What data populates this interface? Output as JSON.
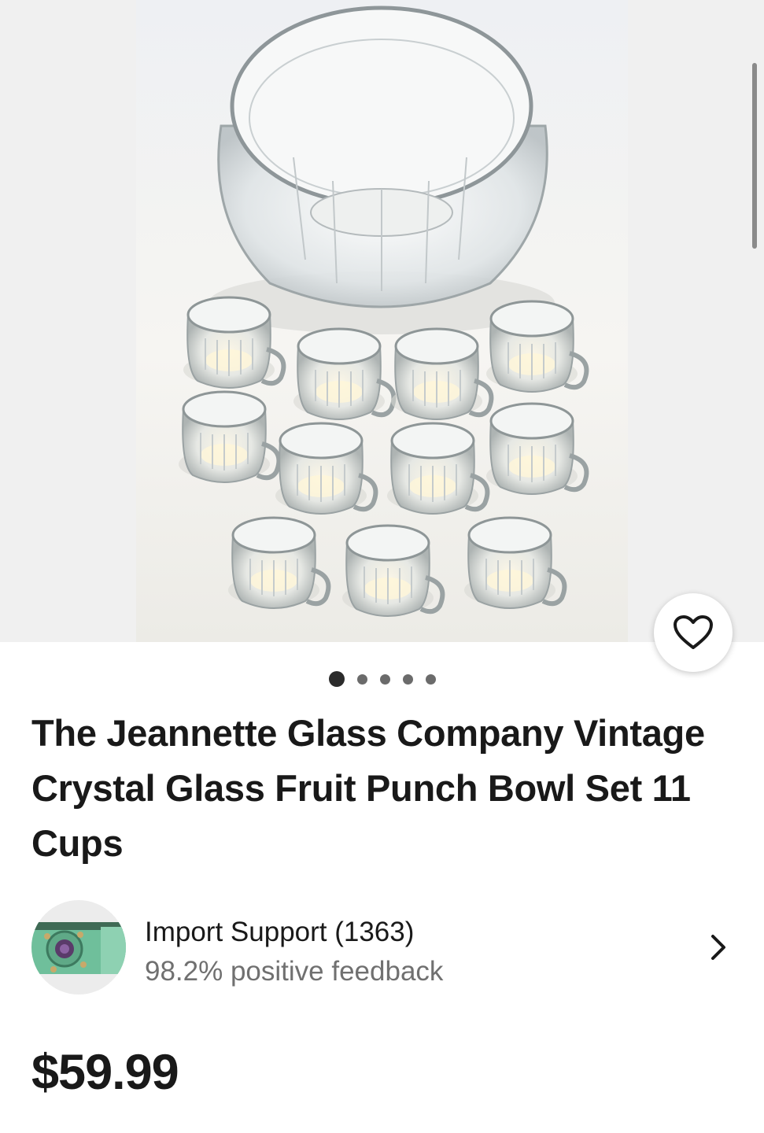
{
  "listing": {
    "title": "The Jeannette Glass Company Vintage Crystal Glass Fruit Punch Bowl Set 11 Cups",
    "price": "$59.99"
  },
  "gallery": {
    "dot_count": 5,
    "active_index": 0,
    "favorite_icon": "heart-outline-icon"
  },
  "seller": {
    "name": "Import Support (1363)",
    "feedback": "98.2% positive feedback",
    "chevron_icon": "chevron-right-icon"
  },
  "colors": {
    "text_primary": "#191919",
    "text_secondary": "#707070",
    "gallery_bg": "#f0f0f0"
  }
}
